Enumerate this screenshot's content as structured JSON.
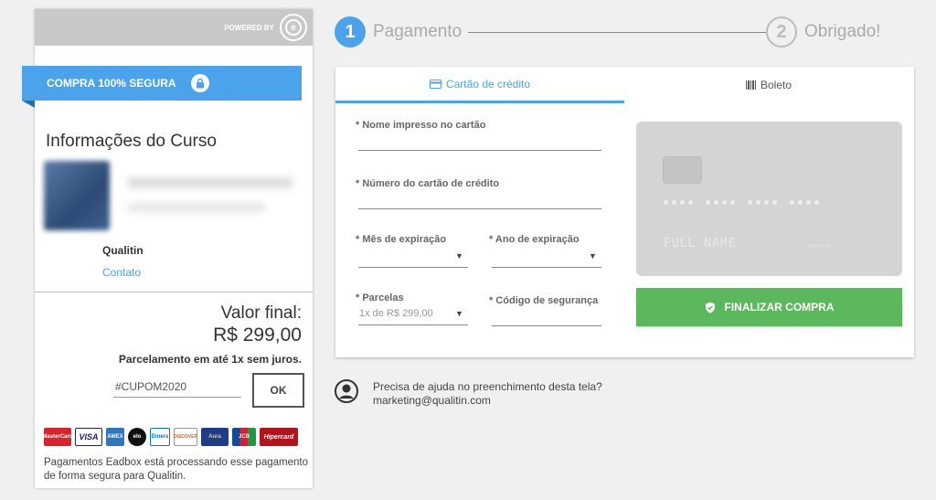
{
  "left_panel": {
    "powered_by": "POWERED BY",
    "secure_badge": "COMPRA 100% SEGURA",
    "course_section_title": "Informações do Curso",
    "org_name": "Qualitin",
    "contact_link": "Contato",
    "final_value_label": "Valor final:",
    "final_value": "R$ 299,00",
    "installments_note": "Parcelamento em até 1x sem juros.",
    "coupon_value": "#CUPOM2020",
    "ok_label": "OK",
    "card_brands": [
      "MasterCard",
      "VISA",
      "AMEX",
      "elo",
      "Diners",
      "DISCOVER",
      "Aura",
      "JCB",
      "Hipercard"
    ],
    "processing_note": "Pagamentos Eadbox está processando esse pagamento de forma segura para Qualitin."
  },
  "steps": [
    {
      "number": "1",
      "label": "Pagamento"
    },
    {
      "number": "2",
      "label": "Obrigado!"
    }
  ],
  "payment": {
    "tabs": [
      {
        "label": "Cartão de crédito",
        "icon": "credit-card-icon"
      },
      {
        "label": "Boleto",
        "icon": "barcode-icon"
      }
    ],
    "fields": {
      "card_name_label": "* Nome impresso no cartão",
      "card_number_label": "* Número do cartão de crédito",
      "exp_month_label": "* Mês de expiração",
      "exp_year_label": "* Ano de expiração",
      "installments_label": "* Parcelas",
      "installments_value": "1x de R$ 299,00",
      "security_code_label": "* Código de segurança"
    },
    "card_preview": {
      "holder": "FULL NAME",
      "expiry": "**/**"
    },
    "submit_label": "FINALIZAR COMPRA"
  },
  "help": {
    "question": "Precisa de ajuda no preenchimento desta tela?",
    "email": "marketing@qualitin.com"
  },
  "colors": {
    "accent_blue": "#4aa3eb",
    "submit_green": "#5cb85c",
    "background": "#f0f0f0"
  }
}
